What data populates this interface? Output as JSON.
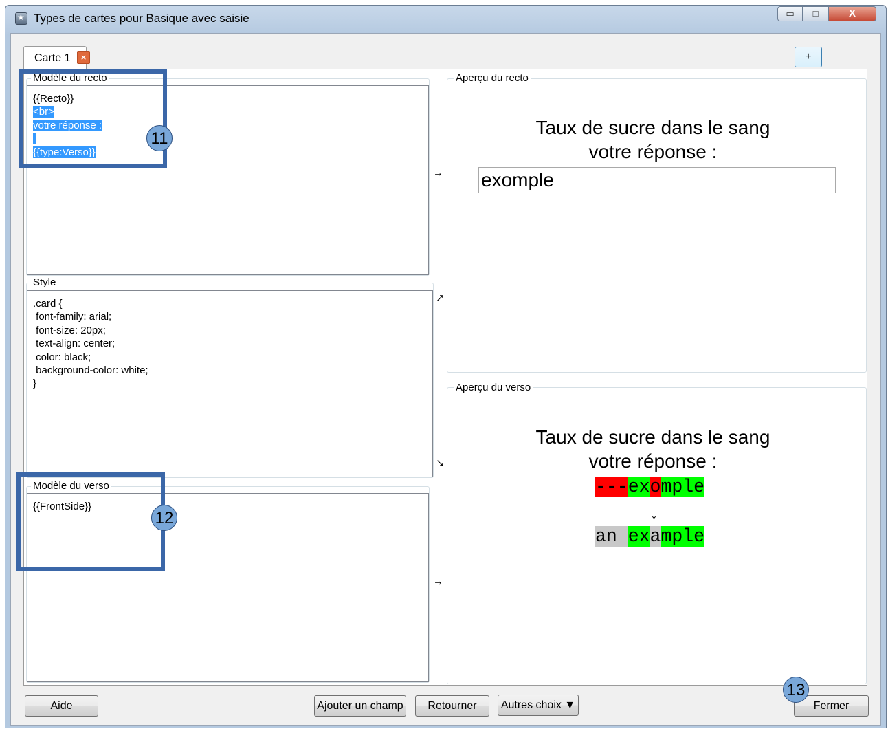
{
  "window": {
    "title": "Types de cartes pour Basique avec saisie",
    "minimize_label": "▭",
    "maximize_label": "□",
    "close_label": "X"
  },
  "tabs": [
    {
      "label": "Carte 1",
      "close_label": "×"
    }
  ],
  "add_card_label": "+",
  "front_template": {
    "legend": "Modèle du recto",
    "lines": [
      "{{Recto}}",
      "<br>",
      "votre réponse :",
      " ",
      "{{type:Verso}}"
    ]
  },
  "style": {
    "legend": "Style",
    "lines": [
      ".card {",
      " font-family: arial;",
      " font-size: 20px;",
      " text-align: center;",
      " color: black;",
      " background-color: white;",
      "}"
    ]
  },
  "back_template": {
    "legend": "Modèle du verso",
    "lines": [
      "{{FrontSide}}"
    ]
  },
  "arrows": {
    "front": "→",
    "style_up": "↗",
    "style_down": "↘",
    "back": "→"
  },
  "front_preview": {
    "legend": "Aperçu du recto",
    "line1": "Taux de sucre dans le sang",
    "line2": "votre réponse :",
    "input_value": "exomple"
  },
  "back_preview": {
    "legend": "Aperçu du verso",
    "line1": "Taux de sucre dans le sang",
    "line2": "votre réponse :",
    "typed": {
      "missing": "---",
      "ok1": "ex",
      "wrong": "o",
      "ok2": "mple"
    },
    "arrow": "↓",
    "expected": {
      "extra": "an ",
      "ok1": "ex",
      "plain": "a",
      "ok2": "mple"
    }
  },
  "callouts": {
    "front_template": "11",
    "back_template": "12",
    "close": "13"
  },
  "buttons": {
    "help": "Aide",
    "add_field": "Ajouter un champ",
    "flip": "Retourner",
    "more": "Autres choix ▼",
    "close": "Fermer"
  },
  "colors": {
    "selection": "#3399ff",
    "diff_bad": "#ff0000",
    "diff_good": "#00ff00",
    "diff_extra": "#c8c8c8",
    "callout": "#3b67a8",
    "callout_badge": "#79a7d9"
  }
}
